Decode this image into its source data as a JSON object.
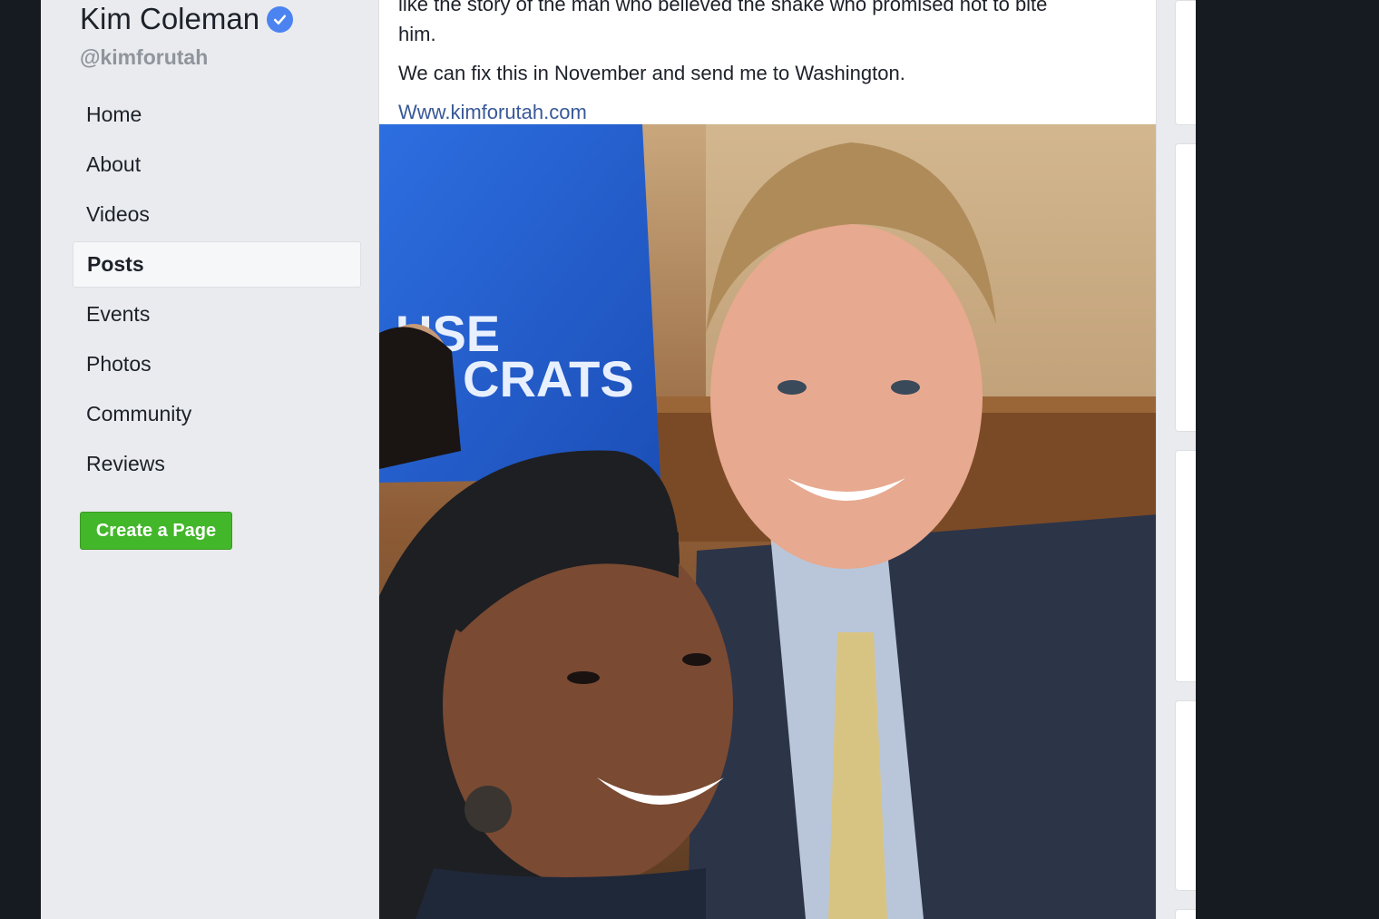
{
  "sidebar": {
    "page_name": "Kim Coleman",
    "handle": "@kimforutah",
    "nav_items": [
      {
        "label": "Home",
        "active": false
      },
      {
        "label": "About",
        "active": false
      },
      {
        "label": "Videos",
        "active": false
      },
      {
        "label": "Posts",
        "active": true
      },
      {
        "label": "Events",
        "active": false
      },
      {
        "label": "Photos",
        "active": false
      },
      {
        "label": "Community",
        "active": false
      },
      {
        "label": "Reviews",
        "active": false
      }
    ],
    "create_page_label": "Create a Page"
  },
  "post": {
    "text_line_partial": "like the story of the man who believed the snake who promised not to bite",
    "text_line_end": "him.",
    "text_second": "We can fix this in November and send me to Washington.",
    "link": "Www.kimforutah.com",
    "photo_sign_text": "CRATS",
    "photo_sign_text_partial": "USE"
  },
  "colors": {
    "verified_badge": "#4b83f0",
    "create_button": "#42b72a",
    "link": "#385898"
  }
}
